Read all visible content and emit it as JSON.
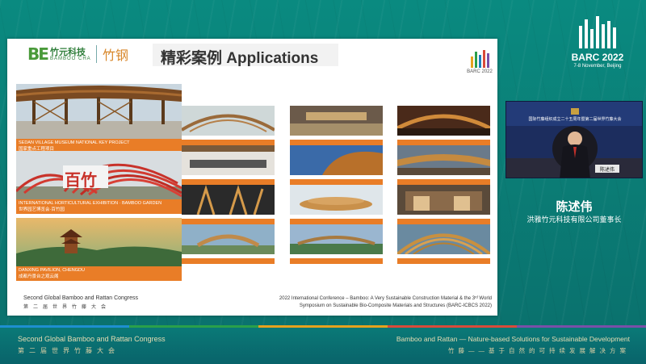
{
  "slide": {
    "logo_cn": "竹元科技",
    "logo_en": "BAMBOO CHA",
    "brand": "竹钢",
    "title": "精彩案例 Applications",
    "barc_text": "BARC 2022",
    "big_photos": [
      {
        "caption_en": "SEDAN VILLAGE MUSEUM  NATIONAL KEY PROJECT",
        "caption_cn": "国家重点工程项目"
      },
      {
        "caption_en": "INTERNATIONAL HORTICULTURAL EXHIBITION · BAMBOO GARDEN",
        "caption_cn": "世界园艺博览会·百竹园"
      },
      {
        "caption_en": "DANXING PAVILION, CHENGDU",
        "caption_cn": "成都丹景台之观云阁"
      }
    ],
    "big_photo_sign": "百竹",
    "footer_left_en": "Second Global Bamboo and Rattan Congress",
    "footer_left_cn": "第二届世界竹藤大会",
    "footer_right_1": "2022 International Conference – Bamboo: A Very Sustainable Construction Material & the 3ʳᵈ World",
    "footer_right_2": "Symposium on Sustainable Bio-Composite Materials and Structures (BARC-ICBCS 2022)"
  },
  "event": {
    "name": "BARC 2022",
    "date": "7-8 November, Beijing"
  },
  "video": {
    "banner": "国际竹藤组织成立二十五周年暨第二届世界竹藤大会",
    "nameplate": "陈述伟"
  },
  "speaker": {
    "name": "陈述伟",
    "title": "洪雅竹元科技有限公司董事长"
  },
  "bottom": {
    "left_en": "Second Global Bamboo and Rattan Congress",
    "left_cn": "第二届世界竹藤大会",
    "right_en": "Bamboo and Rattan — Nature-based Solutions for Sustainable Development",
    "right_cn": "竹藤——基于自然的可持续发展解决方案"
  },
  "colors": {
    "accent_orange": "#e97d27",
    "teal": "#0a8a80",
    "cream_text": "#e7ddb2"
  }
}
